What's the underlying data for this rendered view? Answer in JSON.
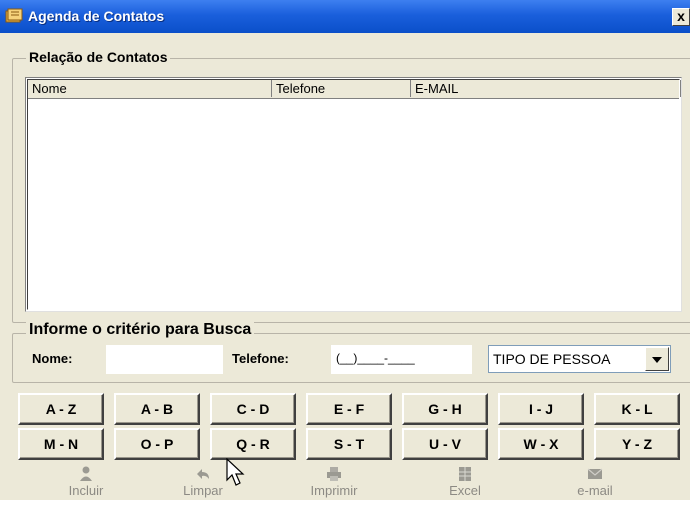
{
  "window": {
    "title": "Agenda de Contatos",
    "close_label": "x"
  },
  "contacts": {
    "legend": "Relação de Contatos",
    "columns": [
      "Nome",
      "Telefone",
      "E-MAIL"
    ],
    "rows": []
  },
  "search": {
    "legend": "Informe o critério para Busca",
    "name_label": "Nome:",
    "name_value": "",
    "phone_label": "Telefone:",
    "phone_value": "(__)____-____",
    "person_type": "TIPO DE PESSOA"
  },
  "letter_buttons": [
    [
      "A - Z",
      "A - B",
      "C - D",
      "E - F",
      "G - H",
      "I - J",
      "K - L"
    ],
    [
      "M - N",
      "O - P",
      "Q - R",
      "S - T",
      "U - V",
      "W - X",
      "Y - Z"
    ]
  ],
  "toolbar": {
    "incluir": "Incluir",
    "limpar": "Limpar",
    "imprimir": "Imprimir",
    "excel": "Excel",
    "email": "e-mail"
  },
  "colors": {
    "titlebar": "#0a4fc9",
    "window_bg": "#ece9d8",
    "disabled_text": "#8c8a84"
  }
}
